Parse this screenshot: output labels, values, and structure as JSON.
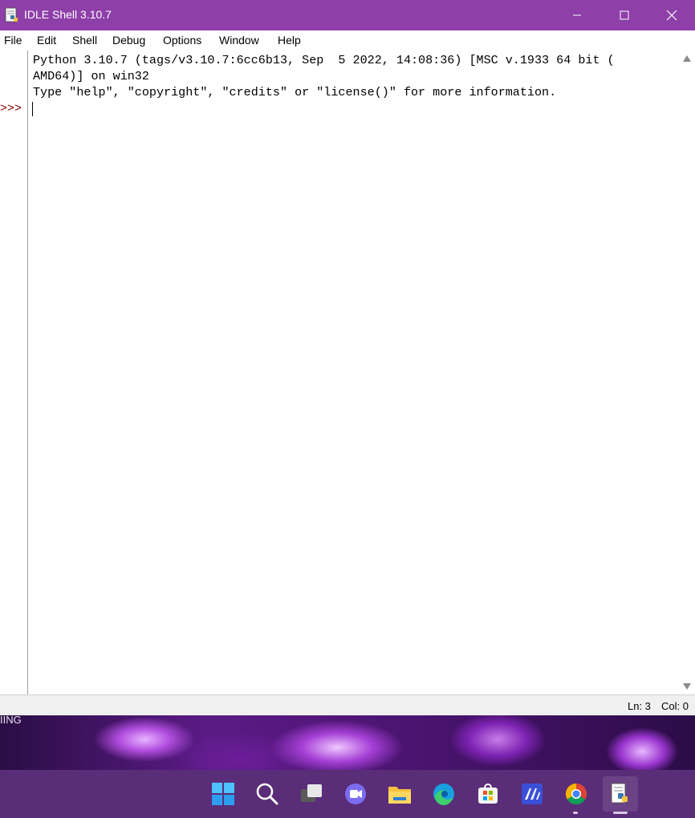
{
  "window": {
    "title": "IDLE Shell 3.10.7"
  },
  "menu": {
    "items": [
      "File",
      "Edit",
      "Shell",
      "Debug",
      "Options",
      "Window",
      "Help"
    ]
  },
  "shell": {
    "prompt": ">>>",
    "lines": [
      "Python 3.10.7 (tags/v3.10.7:6cc6b13, Sep  5 2022, 14:08:36) [MSC v.1933 64 bit (",
      "AMD64)] on win32",
      "Type \"help\", \"copyright\", \"credits\" or \"license()\" for more information."
    ]
  },
  "status": {
    "line": "Ln: 3",
    "col": "Col: 0"
  },
  "desktop": {
    "partial_text": "IING"
  },
  "taskbar": {
    "icons": [
      "windows-start-icon",
      "search-icon",
      "task-view-icon",
      "teams-chat-icon",
      "file-explorer-icon",
      "edge-icon",
      "microsoft-store-icon",
      "app-icon",
      "chrome-icon",
      "idle-python-icon"
    ]
  },
  "colors": {
    "titlebar": "#8e3fa8",
    "prompt": "#8b0000",
    "taskbar": "#5a2d78"
  }
}
